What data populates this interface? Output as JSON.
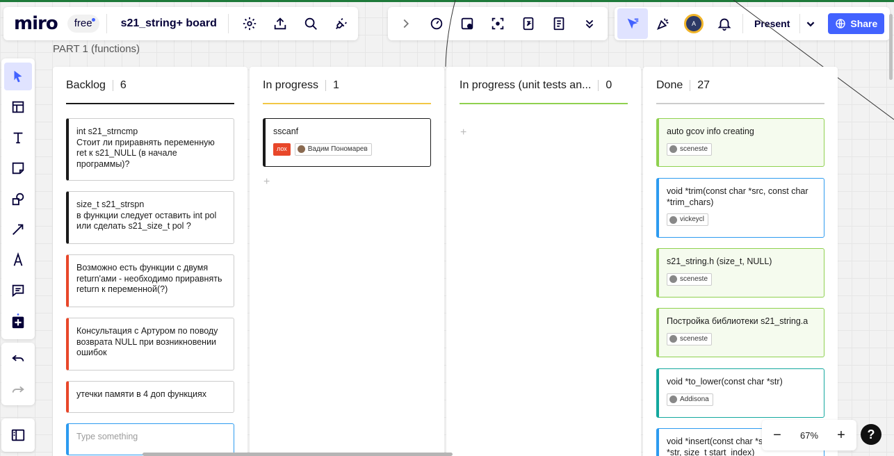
{
  "app": {
    "logo": "miro",
    "plan": "free",
    "board_name": "s21_string+ board"
  },
  "toolbar_right": {
    "present_label": "Present",
    "share_label": "Share",
    "avatar_initial": "A"
  },
  "frame": {
    "title": "PART 1 (functions)"
  },
  "columns": [
    {
      "name": "Backlog",
      "count": "6",
      "color": "#1a1a1a"
    },
    {
      "name": "In progress",
      "count": "1",
      "color": "#f2c744"
    },
    {
      "name": "In progress (unit tests an...",
      "count": "0",
      "color": "#8fd14f"
    },
    {
      "name": "Done",
      "count": "27",
      "color": "#cccccc"
    }
  ],
  "backlog_cards": [
    {
      "text": "int s21_strncmp\nСтоит ли приравнять переменную ret к s21_NULL (в начале программы)?",
      "accent": "#1a1a1a"
    },
    {
      "text": "size_t s21_strspn\nв функции следует оставить int pol или сделать s21_size_t pol ?",
      "accent": "#1a1a1a"
    },
    {
      "text": "Возможно есть функции с двумя return'ами - необходимо приравнять return к переменной(?)",
      "accent": "#e8472a"
    },
    {
      "text": "Консультация с Артуром по поводу возврата NULL при возникновении ошибок",
      "accent": "#e8472a"
    },
    {
      "text": "утечки памяти в 4 доп функциях",
      "accent": "#e8472a"
    }
  ],
  "backlog_new_card": {
    "placeholder": "Type something",
    "accent": "#2d9bf0"
  },
  "inprogress_cards": [
    {
      "text": "sscanf",
      "accent": "#1a1a1a",
      "tag": "лох",
      "user": "Вадим Пономарев"
    }
  ],
  "done_cards": [
    {
      "text": "auto gcov info creating",
      "user": "sceneste",
      "accent": "#8fd14f",
      "bg": "#f5fbee"
    },
    {
      "text": "void *trim(const char *src, const char *trim_chars)",
      "user": "vickeycl",
      "accent": "#2d9bf0",
      "bg": "#ffffff"
    },
    {
      "text": "s21_string.h (size_t, NULL)",
      "user": "sceneste",
      "accent": "#8fd14f",
      "bg": "#f5fbee"
    },
    {
      "text": "Постройка библиотеки s21_string.a",
      "user": "sceneste",
      "accent": "#8fd14f",
      "bg": "#f5fbee"
    },
    {
      "text": "void *to_lower(const char *str)",
      "user": "Addisona",
      "accent": "#13a89e",
      "bg": "#ffffff"
    },
    {
      "text": "void *insert(const char *src, const char *str, size_t start_index)",
      "user": "",
      "accent": "#2d9bf0",
      "bg": "#ffffff"
    }
  ],
  "add_symbol": "+",
  "zoom": {
    "level": "67%",
    "minus": "−",
    "plus": "+"
  },
  "help": {
    "label": "?"
  }
}
